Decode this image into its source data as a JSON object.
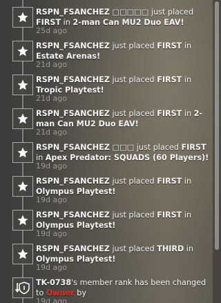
{
  "feed": {
    "items": [
      {
        "icon": "star-icon",
        "user": "RSPN_FSANCHEZ",
        "extra": " □□□□□",
        "mid": " just placed ",
        "place": "FIRST",
        "post": " in ",
        "event": "2-man Can MU2 Duo EAV!",
        "time": "25d ago"
      },
      {
        "icon": "star-icon",
        "user": "RSPN_FSANCHEZ",
        "extra": "",
        "mid": " just placed ",
        "place": "FIRST",
        "post": " in ",
        "event": "Estate Arenas!",
        "time": "21d ago"
      },
      {
        "icon": "star-icon",
        "user": "RSPN_FSANCHEZ",
        "extra": "",
        "mid": " just placed ",
        "place": "FIRST",
        "post": " in ",
        "event": "Tropic Playtest!",
        "time": "21d ago"
      },
      {
        "icon": "star-icon",
        "user": "RSPN_FSANCHEZ",
        "extra": "",
        "mid": " just placed ",
        "place": "FIRST",
        "post": " in ",
        "event": "2-man Can MU2 Duo EAV!",
        "time": "21d ago"
      },
      {
        "icon": "star-icon",
        "user": "RSPN_FSANCHEZ",
        "extra": " □□□",
        "mid": " just placed ",
        "place": "FIRST",
        "post": " in ",
        "event": "Apex Predator: SQUADS (60 Players)!",
        "time": "19d ago"
      },
      {
        "icon": "star-icon",
        "user": "RSPN_FSANCHEZ",
        "extra": "",
        "mid": " just placed ",
        "place": "FIRST",
        "post": " in ",
        "event": "Olympus Playtest!",
        "time": "19d ago"
      },
      {
        "icon": "star-icon",
        "user": "RSPN_FSANCHEZ",
        "extra": "",
        "mid": " just placed ",
        "place": "FIRST",
        "post": " in ",
        "event": "Olympus Playtest!",
        "time": "19d ago"
      },
      {
        "icon": "star-icon",
        "user": "RSPN_FSANCHEZ",
        "extra": "",
        "mid": " just placed ",
        "place": "THIRD",
        "post": " in ",
        "event": "Olympus Playtest!",
        "time": "19d ago"
      }
    ],
    "rank_item": {
      "icon": "rank-change-icon",
      "user": "TK-0738",
      "text": "'s member rank has been changed to ",
      "rank": "Owner",
      "tail": " by",
      "time": "19d ago"
    }
  },
  "colors": {
    "rank_red": "#e2312b",
    "timestamp": "#9d9b95",
    "text": "#f4f4f4"
  }
}
